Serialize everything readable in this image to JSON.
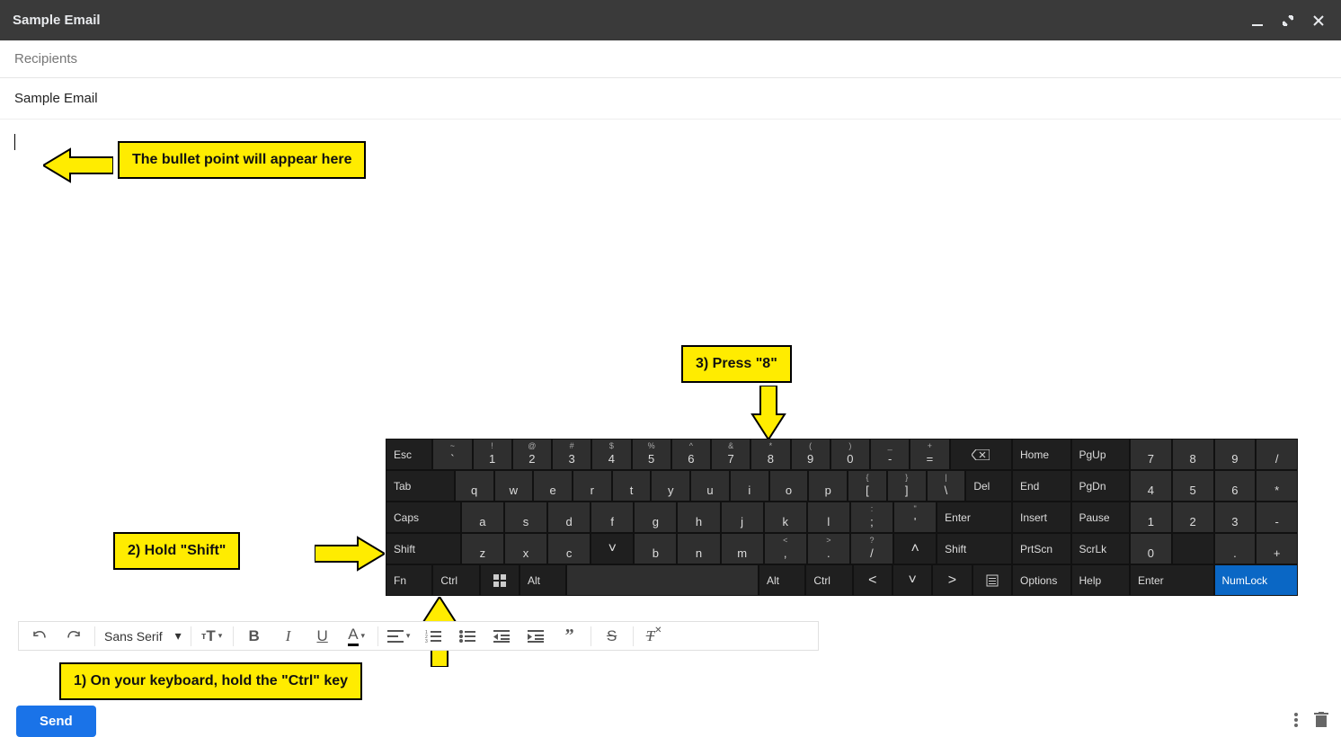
{
  "header": {
    "title": "Sample Email"
  },
  "fields": {
    "recipients_placeholder": "Recipients",
    "subject_value": "Sample Email"
  },
  "callouts": {
    "bullet": "The bullet point will appear here",
    "step1": "1) On your keyboard, hold the \"Ctrl\" key",
    "step2": "2) Hold \"Shift\"",
    "step3": "3) Press  \"8\""
  },
  "keyboard": {
    "row1": [
      "Esc",
      "`~",
      "1!",
      "2@",
      "3#",
      "4$",
      "5%",
      "6^",
      "7&",
      "8*",
      "9(",
      "0)",
      "-_",
      "=+",
      "BKSP"
    ],
    "row2": [
      "Tab",
      "q",
      "w",
      "e",
      "r",
      "t",
      "y",
      "u",
      "i",
      "o",
      "p",
      "[{",
      "]}",
      "\\|",
      "Del"
    ],
    "row3": [
      "Caps",
      "a",
      "s",
      "d",
      "f",
      "g",
      "h",
      "j",
      "k",
      "l",
      ";:",
      "'\"",
      "Enter"
    ],
    "row4": [
      "Shift",
      "z",
      "x",
      "c",
      "v",
      "b",
      "n",
      "m",
      ",<",
      ".>",
      "/?",
      "^",
      "Shift"
    ],
    "row5": [
      "Fn",
      "Ctrl",
      "WIN",
      "Alt",
      "SPACE",
      "Alt",
      "Ctrl",
      "<",
      "v",
      ">",
      "MENU"
    ],
    "mid": [
      [
        "Home",
        "PgUp"
      ],
      [
        "End",
        "PgDn"
      ],
      [
        "Insert",
        "Pause"
      ],
      [
        "PrtScn",
        "ScrLk"
      ],
      [
        "Options",
        "Help"
      ]
    ],
    "num": [
      [
        "7",
        "8",
        "9",
        "/"
      ],
      [
        "4",
        "5",
        "6",
        "*"
      ],
      [
        "1",
        "2",
        "3",
        "-"
      ],
      [
        "0",
        "",
        ".",
        "+"
      ],
      [
        "Enter",
        "",
        "NumLock",
        ""
      ]
    ]
  },
  "toolbar": {
    "font": "Sans Serif",
    "send": "Send"
  }
}
